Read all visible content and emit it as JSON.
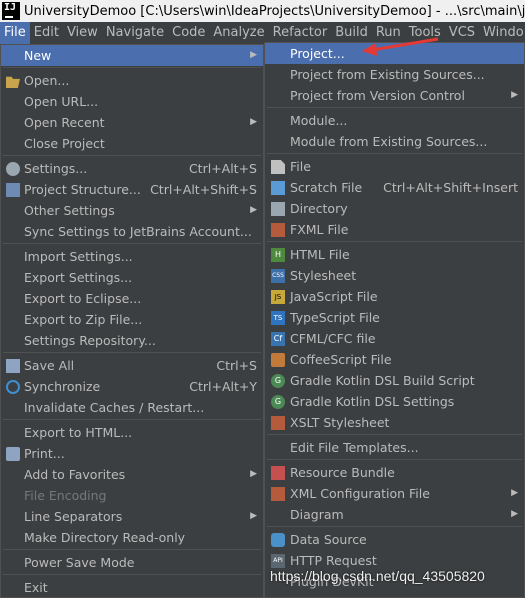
{
  "window": {
    "title": "UniversityDemoo [C:\\Users\\win\\IdeaProjects\\UniversityDemoo] - ...\\src\\main\\java\\servi"
  },
  "menubar": [
    "File",
    "Edit",
    "View",
    "Navigate",
    "Code",
    "Analyze",
    "Refactor",
    "Build",
    "Run",
    "Tools",
    "VCS",
    "Windo"
  ],
  "file_menu": {
    "new": "New",
    "open": "Open...",
    "open_url": "Open URL...",
    "open_recent": "Open Recent",
    "close_project": "Close Project",
    "settings": "Settings...",
    "settings_sc": "Ctrl+Alt+S",
    "project_structure": "Project Structure...",
    "project_structure_sc": "Ctrl+Alt+Shift+S",
    "other_settings": "Other Settings",
    "sync_settings": "Sync Settings to JetBrains Account...",
    "import_settings": "Import Settings...",
    "export_settings": "Export Settings...",
    "export_eclipse": "Export to Eclipse...",
    "export_zip": "Export to Zip File...",
    "settings_repo": "Settings Repository...",
    "save_all": "Save All",
    "save_all_sc": "Ctrl+S",
    "synchronize": "Synchronize",
    "synchronize_sc": "Ctrl+Alt+Y",
    "invalidate": "Invalidate Caches / Restart...",
    "export_html": "Export to HTML...",
    "print": "Print...",
    "add_favorites": "Add to Favorites",
    "file_encoding": "File Encoding",
    "line_separators": "Line Separators",
    "make_readonly": "Make Directory Read-only",
    "power_save": "Power Save Mode",
    "exit": "Exit"
  },
  "new_menu": {
    "project": "Project...",
    "from_existing": "Project from Existing Sources...",
    "from_vcs": "Project from Version Control",
    "module": "Module...",
    "module_existing": "Module from Existing Sources...",
    "file": "File",
    "scratch": "Scratch File",
    "scratch_sc": "Ctrl+Alt+Shift+Insert",
    "directory": "Directory",
    "fxml": "FXML File",
    "html": "HTML File",
    "stylesheet": "Stylesheet",
    "javascript": "JavaScript File",
    "typescript": "TypeScript File",
    "cfml": "CFML/CFC file",
    "coffeescript": "CoffeeScript File",
    "gradle_build": "Gradle Kotlin DSL Build Script",
    "gradle_settings": "Gradle Kotlin DSL Settings",
    "xslt": "XSLT Stylesheet",
    "edit_templates": "Edit File Templates...",
    "resource_bundle": "Resource Bundle",
    "xml_config": "XML Configuration File",
    "diagram": "Diagram",
    "data_source": "Data Source",
    "http_request": "HTTP Request",
    "plugin_devkit": "Plugin DevKit"
  },
  "watermark": "https://blog.csdn.net/qq_43505820",
  "colors": {
    "menu_bg": "#3c3f41",
    "highlight": "#4b6eaf",
    "annotation": "#e53935"
  }
}
